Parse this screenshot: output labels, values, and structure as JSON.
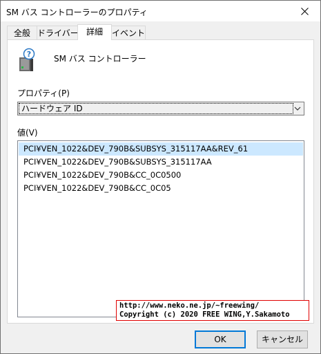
{
  "window": {
    "title": "SM バス コントローラーのプロパティ"
  },
  "tabs": [
    {
      "label": "全般"
    },
    {
      "label": "ドライバー"
    },
    {
      "label": "詳細"
    },
    {
      "label": "イベント"
    }
  ],
  "device": {
    "name": "SM バス コントローラー",
    "icon": "device-unknown-icon"
  },
  "property": {
    "label": "プロパティ(P)",
    "selected": "ハードウェア ID"
  },
  "values": {
    "label": "値(V)",
    "items": [
      "PCI¥VEN_1022&DEV_790B&SUBSYS_315117AA&REV_61",
      "PCI¥VEN_1022&DEV_790B&SUBSYS_315117AA",
      "PCI¥VEN_1022&DEV_790B&CC_0C0500",
      "PCI¥VEN_1022&DEV_790B&CC_0C05"
    ],
    "selected_index": 0
  },
  "watermark": {
    "line1": "http://www.neko.ne.jp/~freewing/",
    "line2": "Copyright (c) 2020 FREE WING,Y.Sakamoto"
  },
  "buttons": {
    "ok": "OK",
    "cancel": "キャンセル"
  },
  "colors": {
    "selection": "#cce8ff",
    "default_button_border": "#0078d7",
    "watermark_border": "#e00000"
  }
}
